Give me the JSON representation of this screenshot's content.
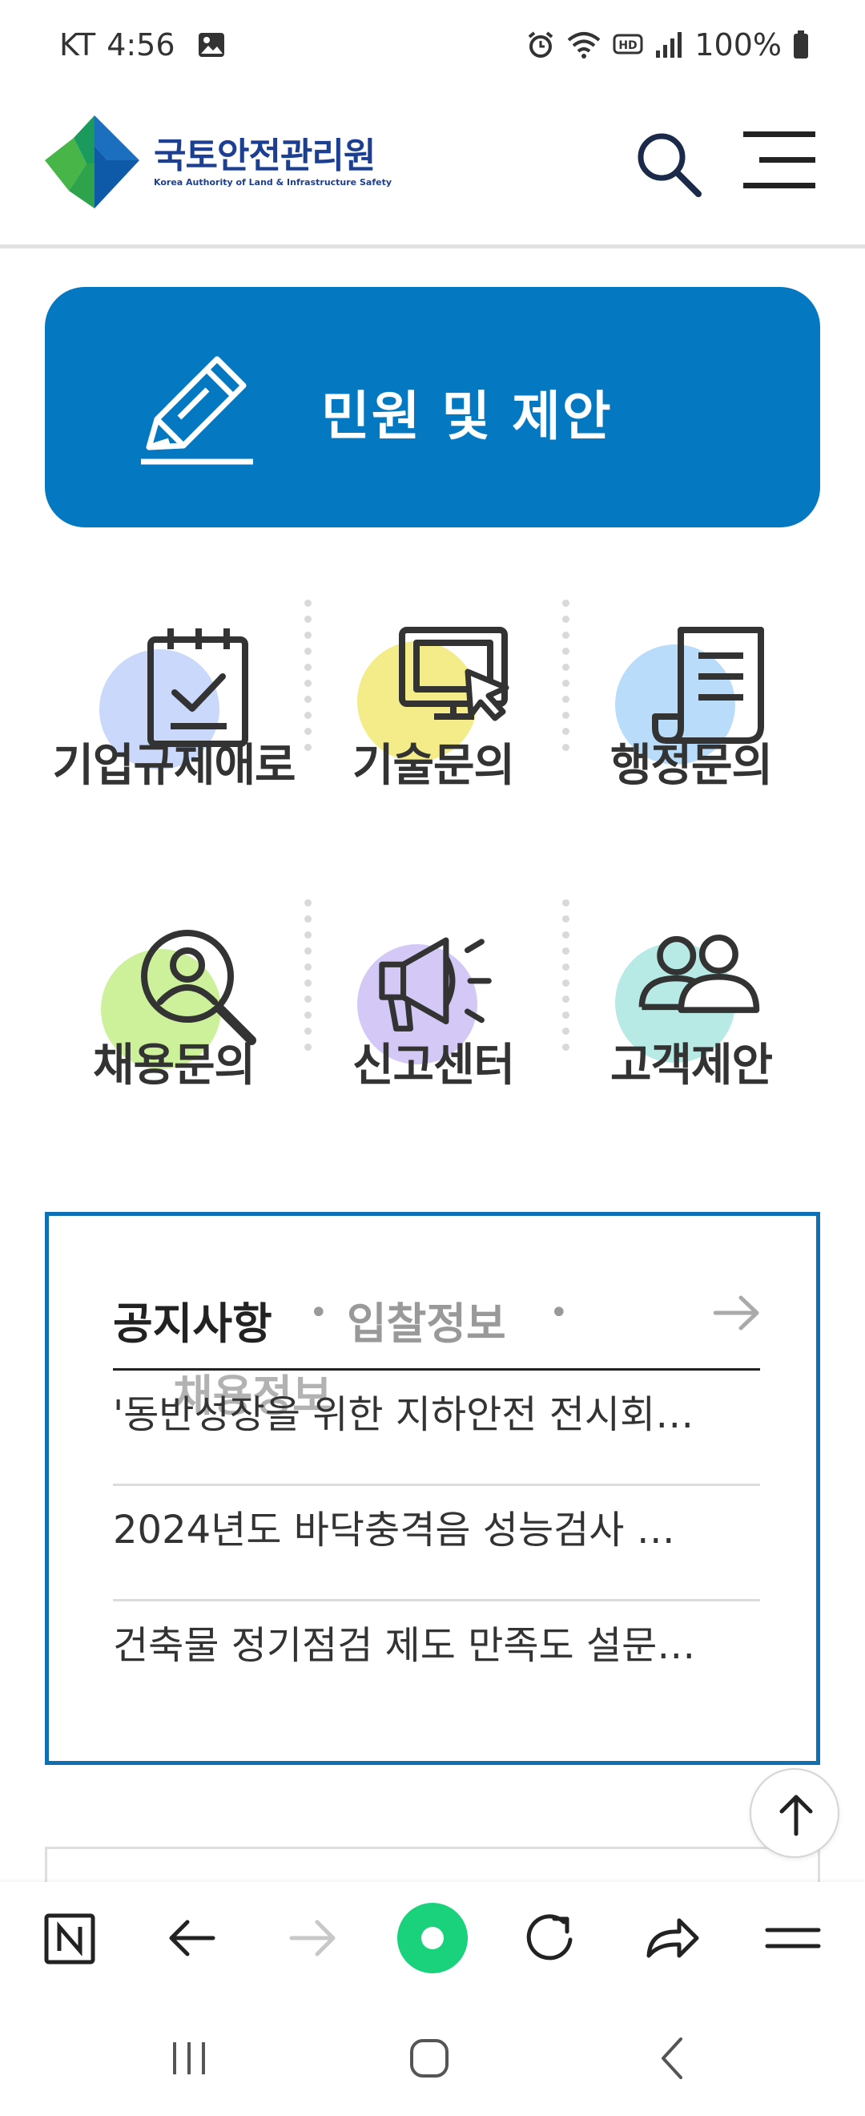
{
  "status_bar": {
    "carrier": "KT",
    "time": "4:56",
    "battery": "100%"
  },
  "header": {
    "logo_ko": "국토안전관리원",
    "logo_en": "Korea Authority of Land & Infrastructure Safety"
  },
  "banner": {
    "label": "민원 및 제안"
  },
  "services": [
    {
      "label": "기업규제애로",
      "icon": "clipboard-check-icon",
      "circle_color": "#c9d8fb"
    },
    {
      "label": "기술문의",
      "icon": "monitor-cursor-icon",
      "circle_color": "#f3ec88"
    },
    {
      "label": "행정문의",
      "icon": "document-icon",
      "circle_color": "#b9dcfb"
    },
    {
      "label": "채용문의",
      "icon": "person-search-icon",
      "circle_color": "#cdf09a"
    },
    {
      "label": "신고센터",
      "icon": "megaphone-icon",
      "circle_color": "#d3c8f6"
    },
    {
      "label": "고객제안",
      "icon": "people-icon",
      "circle_color": "#b7e9e5"
    }
  ],
  "notice": {
    "tabs": [
      "공지사항",
      "입찰정보",
      "채용정보"
    ],
    "separator": "•",
    "items": [
      "'동반성장을 위한 지하안전 전시회…",
      "2024년도 바닥충격음 성능검사 …",
      "건축물 정기점검 제도 만족도 설문…"
    ]
  },
  "colors": {
    "brand_blue": "#0578c2",
    "notice_border": "#0e6fb3",
    "accent_green": "#19d27b"
  }
}
